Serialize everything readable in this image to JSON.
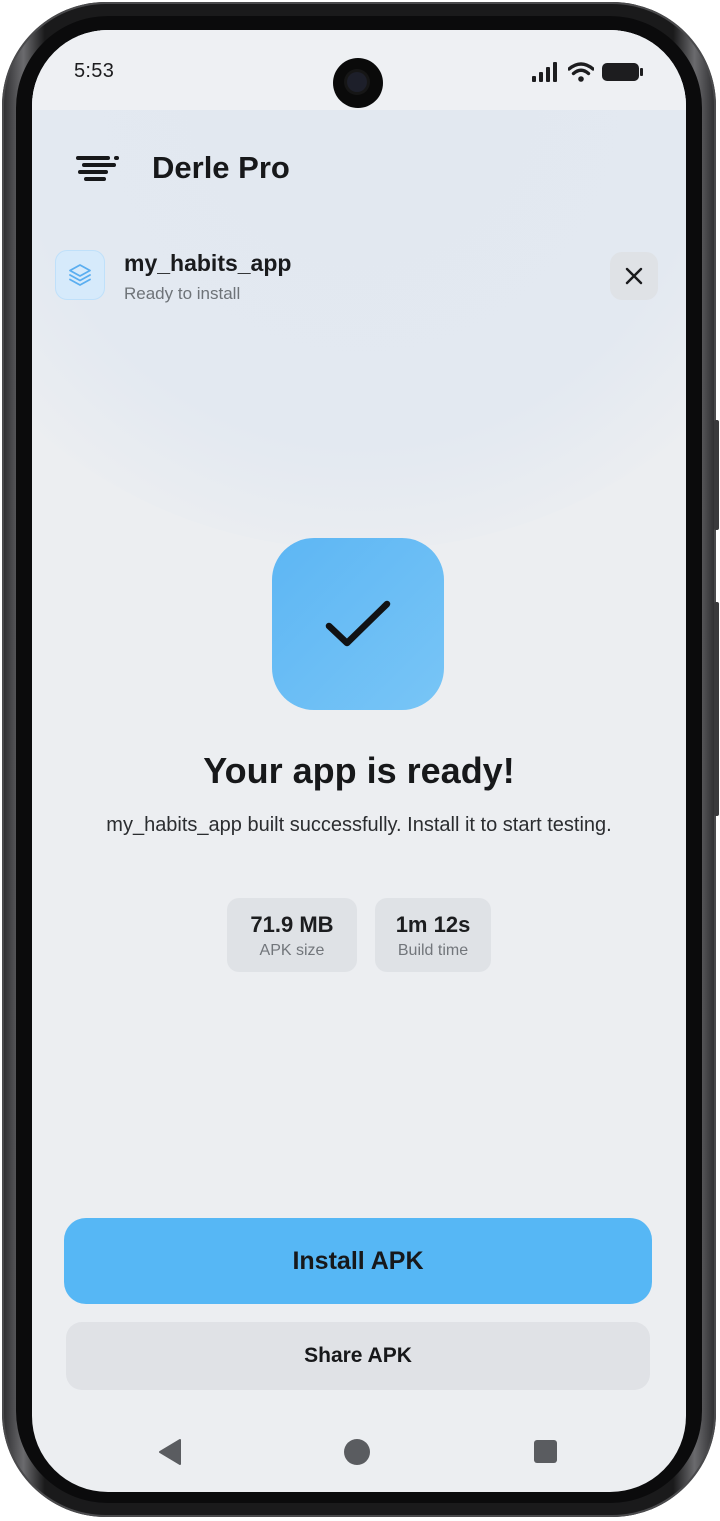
{
  "status_bar": {
    "time": "5:53",
    "icons": [
      "signal-icon",
      "wifi-icon",
      "battery-icon"
    ]
  },
  "app": {
    "title": "Derle Pro",
    "menu_icon": "menu-icon"
  },
  "project": {
    "icon": "layers-icon",
    "name": "my_habits_app",
    "status": "Ready to install",
    "close_icon": "close-icon"
  },
  "result": {
    "icon": "checkmark-icon",
    "headline": "Your app is ready!",
    "message": "my_habits_app built successfully. Install it to start testing."
  },
  "stats": [
    {
      "value": "71.9 MB",
      "label": "APK size"
    },
    {
      "value": "1m 12s",
      "label": "Build time"
    }
  ],
  "actions": {
    "install_label": "Install APK",
    "share_label": "Share APK"
  },
  "nav": {
    "back_icon": "back-triangle-icon",
    "home_icon": "home-circle-icon",
    "recents_icon": "recents-square-icon"
  },
  "colors": {
    "accent": "#56b7f5",
    "background": "#eceef1",
    "chip": "#dfe2e6"
  }
}
